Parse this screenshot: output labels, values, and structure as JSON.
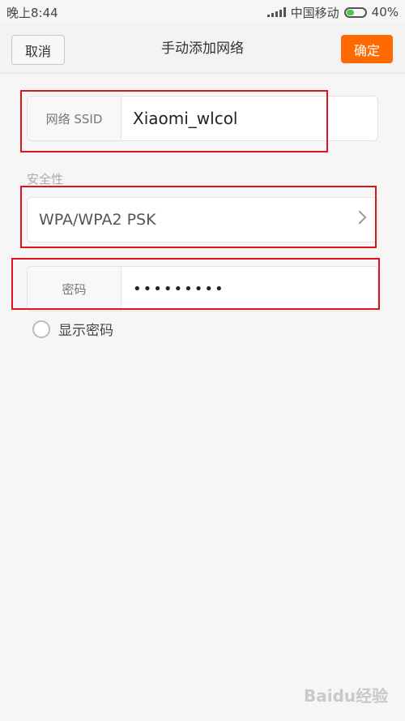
{
  "status_bar": {
    "time": "晚上8:44",
    "carrier": "中国移动",
    "battery": "40%",
    "battery_level": 0.4
  },
  "header": {
    "cancel_label": "取消",
    "title": "手动添加网络",
    "confirm_label": "确定"
  },
  "form": {
    "ssid_label": "网络 SSID",
    "ssid_value": "Xiaomi_wlcol",
    "security_section_label": "安全性",
    "security_value": "WPA/WPA2 PSK",
    "password_label": "密码",
    "password_value": "•••••••••",
    "show_password_label": "显示密码"
  },
  "watermark": "Baidu经验",
  "colors": {
    "accent": "#ff6a00",
    "annotation": "#e0141e"
  }
}
